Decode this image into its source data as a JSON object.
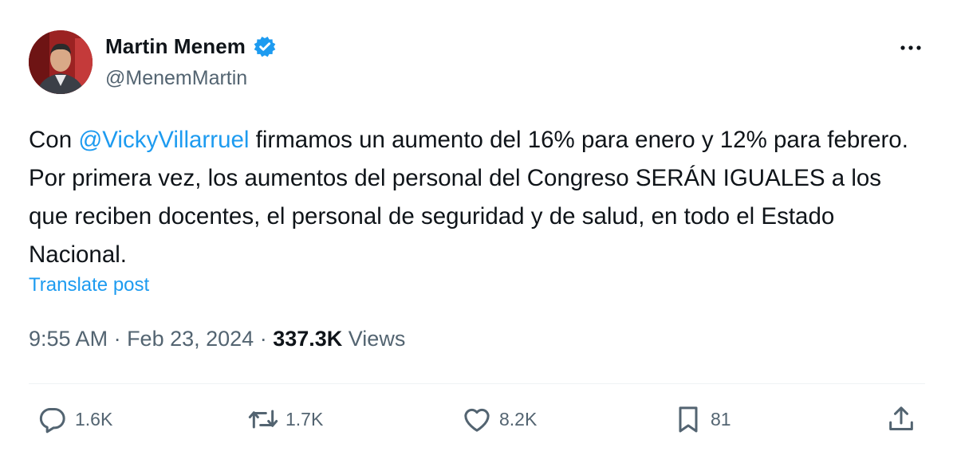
{
  "author": {
    "name": "Martin Menem",
    "handle": "@MenemMartin",
    "verified": true
  },
  "post": {
    "text_before": "Con ",
    "mention": "@VickyVillarruel",
    "text_after": " firmamos un aumento del 16% para enero y 12% para febrero. Por primera vez, los aumentos del personal del Congreso SERÁN IGUALES a los que reciben docentes, el personal de seguridad y de salud, en todo el Estado Nacional.",
    "translate_label": "Translate post"
  },
  "meta": {
    "time": "9:55 AM",
    "separator": " · ",
    "date": "Feb 23, 2024",
    "views_count": "337.3K",
    "views_label": " Views"
  },
  "actions": {
    "reply_count": "1.6K",
    "repost_count": "1.7K",
    "like_count": "8.2K",
    "bookmark_count": "81"
  },
  "colors": {
    "accent": "#1d9bf0",
    "text": "#0f1419",
    "secondary": "#536471"
  }
}
